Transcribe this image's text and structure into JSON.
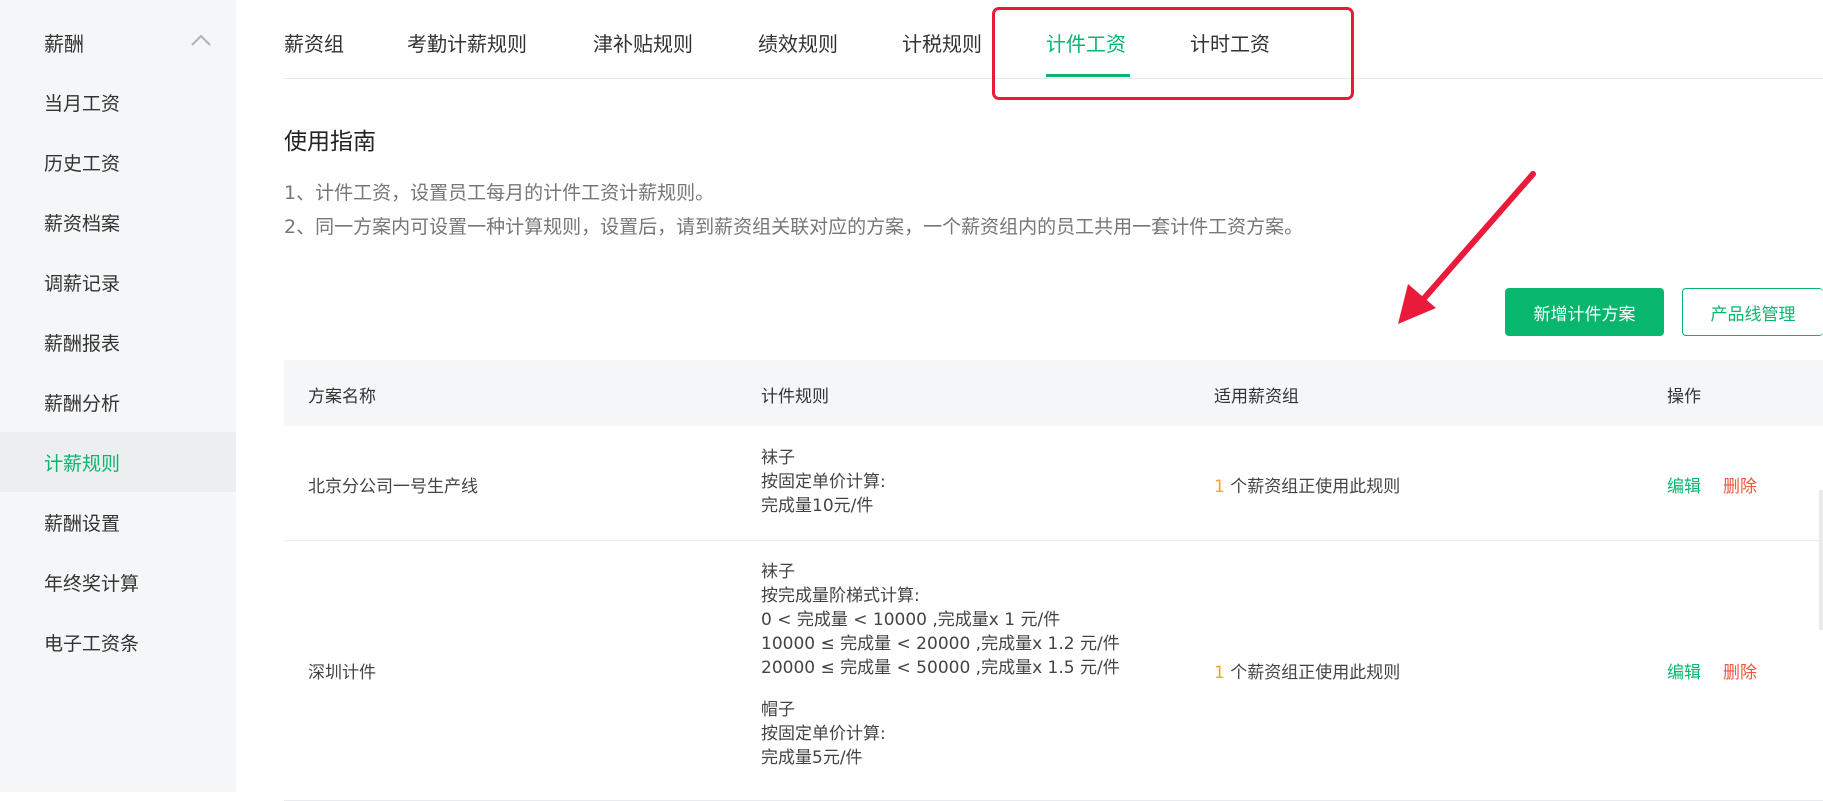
{
  "sidebar": {
    "group_label": "薪酬",
    "items": [
      {
        "label": "当月工资"
      },
      {
        "label": "历史工资"
      },
      {
        "label": "薪资档案"
      },
      {
        "label": "调薪记录"
      },
      {
        "label": "薪酬报表"
      },
      {
        "label": "薪酬分析"
      },
      {
        "label": "计薪规则"
      },
      {
        "label": "薪酬设置"
      },
      {
        "label": "年终奖计算"
      },
      {
        "label": "电子工资条"
      }
    ],
    "active_item": "计薪规则"
  },
  "tabs": [
    {
      "label": "薪资组"
    },
    {
      "label": "考勤计薪规则"
    },
    {
      "label": "津补贴规则"
    },
    {
      "label": "绩效规则"
    },
    {
      "label": "计税规则"
    },
    {
      "label": "计件工资"
    },
    {
      "label": "计时工资"
    }
  ],
  "active_tab": "计件工资",
  "guide": {
    "title": "使用指南",
    "lines": [
      "1、计件工资，设置员工每月的计件工资计薪规则。",
      "2、同一方案内可设置一种计算规则，设置后，请到薪资组关联对应的方案，一个薪资组内的员工共用一套计件工资方案。"
    ]
  },
  "buttons": {
    "add_plan": "新增计件方案",
    "product_line": "产品线管理"
  },
  "table": {
    "headers": [
      "方案名称",
      "计件规则",
      "适用薪资组",
      "操作"
    ],
    "rows": [
      {
        "name": "北京分公司一号生产线",
        "rules": [
          {
            "lines": [
              "袜子",
              "按固定单价计算:",
              "完成量10元/件"
            ]
          }
        ],
        "group_count": "1",
        "group_text": " 个薪资组正使用此规则",
        "edit": "编辑",
        "delete": "删除"
      },
      {
        "name": "深圳计件",
        "rules": [
          {
            "lines": [
              "袜子",
              "按完成量阶梯式计算:",
              "0 < 完成量 < 10000 ,完成量x 1 元/件",
              "10000 ≤ 完成量 < 20000 ,完成量x 1.2 元/件",
              "20000 ≤ 完成量 < 50000 ,完成量x 1.5 元/件"
            ]
          },
          {
            "lines": [
              "帽子",
              "按固定单价计算:",
              "完成量5元/件"
            ]
          }
        ],
        "group_count": "1",
        "group_text": " 个薪资组正使用此规则",
        "edit": "编辑",
        "delete": "删除"
      }
    ]
  },
  "colors": {
    "accent": "#08b66e",
    "highlight": "#ea1a3a",
    "warning": "#f5a623",
    "danger": "#f0563a"
  },
  "icons": {
    "collapse": "chevron-up-icon",
    "annotation": "red-arrow-icon"
  }
}
